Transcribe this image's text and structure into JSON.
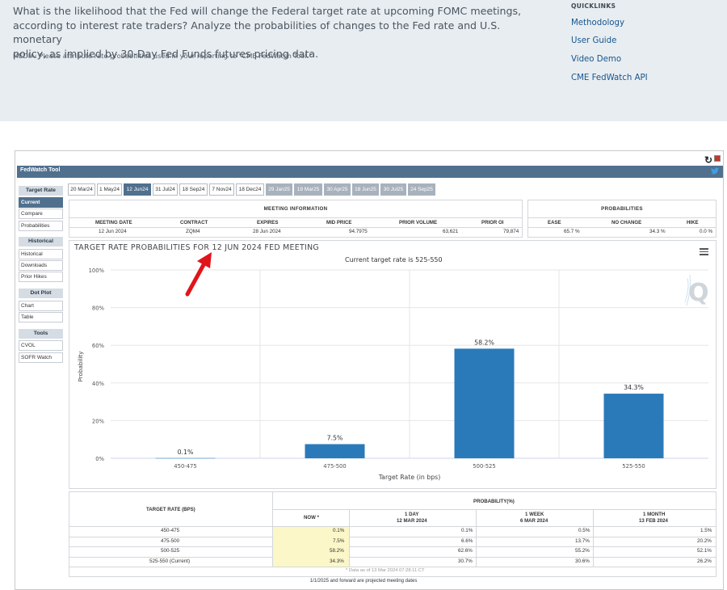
{
  "intro": {
    "lines": [
      "What is the likelihood that the Fed will change the Federal target rate at upcoming FOMC meetings,",
      "according to interest rate traders? Analyze the probabilities of changes to the Fed rate and U.S. monetary",
      "policy, as implied by 30-Day Fed Funds futures pricing data."
    ],
    "media": "MEDIA: Please attribute rate probabilities used in your reporting to \"CME FedWatch Tool.\""
  },
  "quicklinks": {
    "title": "QUICKLINKS",
    "links": [
      "Methodology",
      "User Guide",
      "Video Demo",
      "CME FedWatch API"
    ]
  },
  "tool": {
    "title": "FedWatch Tool",
    "icons": {
      "reload": "reload-icon",
      "close": "close-icon",
      "share": "twitter-icon"
    }
  },
  "sidebar": {
    "sections": [
      {
        "title": "Target Rate",
        "items": [
          "Current",
          "Compare",
          "Probabilities"
        ],
        "active": "Current"
      },
      {
        "title": "Historical",
        "items": [
          "Historical",
          "Downloads",
          "Prior Hikes"
        ]
      },
      {
        "title": "Dot Plot",
        "items": [
          "Chart",
          "Table"
        ]
      },
      {
        "title": "Tools",
        "items": [
          "CVOL",
          "SOFR Watch"
        ]
      }
    ]
  },
  "tabs": {
    "items": [
      "20 Mar24",
      "1 May24",
      "12 Jun24",
      "31 Jul24",
      "18 Sep24",
      "7 Nov24",
      "18 Dec24",
      "29 Jan25",
      "19 Mar25",
      "30 Apr25",
      "18 Jun25",
      "30 Jul25",
      "24 Sep25"
    ],
    "active": "12 Jun24",
    "projected": [
      "29 Jan25",
      "19 Mar25",
      "30 Apr25",
      "18 Jun25",
      "30 Jul25",
      "24 Sep25"
    ]
  },
  "meeting_info": {
    "title": "MEETING INFORMATION",
    "headers": [
      "MEETING DATE",
      "CONTRACT",
      "EXPIRES",
      "MID PRICE",
      "PRIOR VOLUME",
      "PRIOR OI"
    ],
    "values": [
      "12 Jun 2024",
      "ZQM4",
      "28 Jun 2024",
      "94.7975",
      "63,621",
      "79,874"
    ]
  },
  "probabilities_summary": {
    "title": "PROBABILITIES",
    "headers": [
      "EASE",
      "NO CHANGE",
      "HIKE"
    ],
    "values": [
      "65.7 %",
      "34.3 %",
      "0.0 %"
    ]
  },
  "chart": {
    "title": "TARGET RATE PROBABILITIES FOR 12 JUN 2024 FED MEETING",
    "subtitle": "Current target rate is 525-550",
    "menu_icon": "hamburger-menu-icon",
    "watermark_letter": "Q",
    "annotation": "red-arrow-annotation",
    "bar_color": "#2a7ab9"
  },
  "chart_data": {
    "type": "bar",
    "categories": [
      "450-475",
      "475-500",
      "500-525",
      "525-550"
    ],
    "values": [
      0.1,
      7.5,
      58.2,
      34.3
    ],
    "value_labels": [
      "0.1%",
      "7.5%",
      "58.2%",
      "34.3%"
    ],
    "xlabel": "Target Rate (in bps)",
    "ylabel": "Probability",
    "ylim": [
      0,
      100
    ],
    "yticks": [
      0,
      20,
      40,
      60,
      80,
      100
    ],
    "ytick_labels": [
      "0%",
      "20%",
      "40%",
      "60%",
      "80%",
      "100%"
    ],
    "grid": true
  },
  "prob_table": {
    "col_header": "TARGET RATE (BPS)",
    "group_header": "PROBABILITY(%)",
    "sub_headers": [
      {
        "line1": "NOW *",
        "line2": ""
      },
      {
        "line1": "1 DAY",
        "line2": "12 MAR 2024"
      },
      {
        "line1": "1 WEEK",
        "line2": "6 MAR 2024"
      },
      {
        "line1": "1 MONTH",
        "line2": "13 FEB 2024"
      }
    ],
    "rows": [
      {
        "rate": "450-475",
        "vals": [
          "0.1%",
          "0.1%",
          "0.5%",
          "1.5%"
        ]
      },
      {
        "rate": "475-500",
        "vals": [
          "7.5%",
          "6.6%",
          "13.7%",
          "20.2%"
        ]
      },
      {
        "rate": "500-525",
        "vals": [
          "58.2%",
          "62.6%",
          "55.2%",
          "52.1%"
        ]
      },
      {
        "rate": "525-550 (Current)",
        "vals": [
          "34.3%",
          "30.7%",
          "30.6%",
          "26.2%"
        ]
      }
    ],
    "data_note": "* Data as of 13 Mar 2024 07:28:11 CT",
    "now_highlight": "#fbf7c8"
  },
  "footer": "1/1/2025 and forward are projected meeting dates"
}
